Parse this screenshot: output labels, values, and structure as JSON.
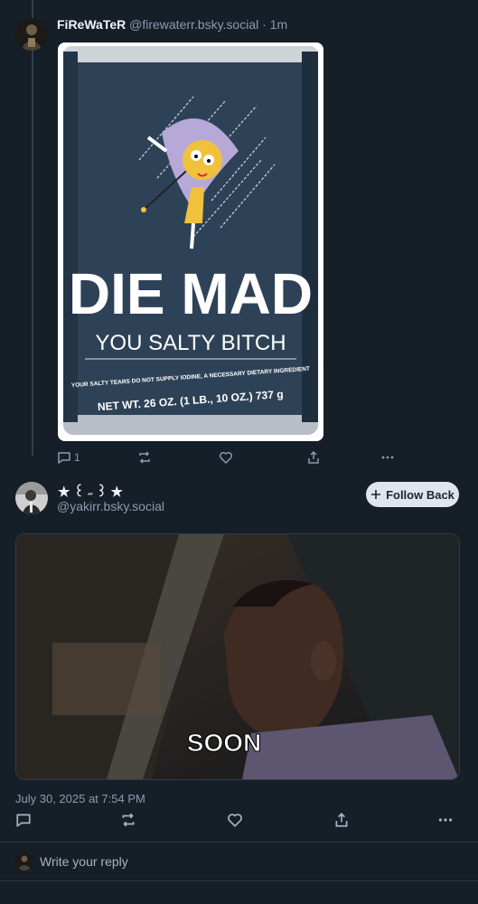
{
  "parent_post": {
    "author_name": "FiReWaTeR",
    "author_handle": "@firewaterr.bsky.social",
    "separator": "·",
    "age": "1m",
    "image_text": {
      "headline": "DIE MAD",
      "subline": "YOU SALTY BITCH",
      "fine_print": "YOUR SALTY TEARS DO NOT SUPPLY IODINE, A NECESSARY DIETARY INGREDIENT",
      "net_weight": "NET WT. 26 OZ. (1 LB., 10 OZ.) 737 g"
    },
    "actions": {
      "reply_count": "1"
    }
  },
  "main_post": {
    "display_name": "★ ꒰ ˶ ꒱ ★",
    "handle": "@yakirr.bsky.social",
    "follow_button_label": "Follow Back",
    "media_caption": "SOON",
    "timestamp": "July 30, 2025 at 7:54 PM"
  },
  "reply_box": {
    "placeholder": "Write your reply"
  },
  "colors": {
    "background": "#161e27",
    "text_muted": "#8a9bb0",
    "follow_button_bg": "#dfe5ec",
    "can_blue": "#2e4257"
  }
}
